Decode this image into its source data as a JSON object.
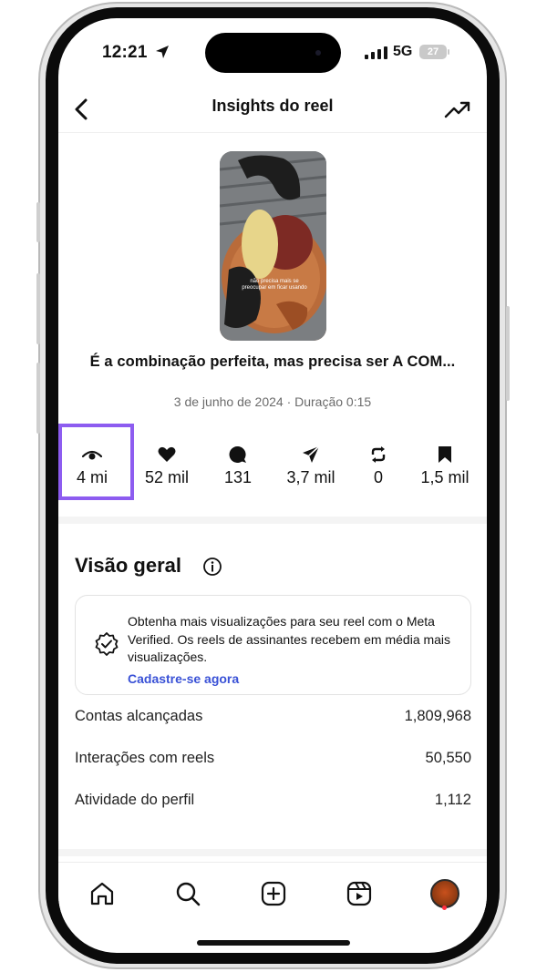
{
  "status_bar": {
    "time": "12:21",
    "network": "5G",
    "battery": "27"
  },
  "header": {
    "title": "Insights do reel"
  },
  "reel": {
    "thumbnail_overlay": "não precisa mais se preocupar em ficar usando",
    "caption": "É a combinação perfeita, mas precisa ser A COM...",
    "meta": "3 de junho de 2024 · Duração 0:15"
  },
  "metrics": [
    {
      "icon": "eye-icon",
      "value": "4 mi"
    },
    {
      "icon": "heart-icon",
      "value": "52 mil"
    },
    {
      "icon": "comment-icon",
      "value": "131"
    },
    {
      "icon": "send-icon",
      "value": "3,7 mil"
    },
    {
      "icon": "repost-icon",
      "value": "0"
    },
    {
      "icon": "bookmark-icon",
      "value": "1,5 mil"
    }
  ],
  "overview": {
    "title": "Visão geral",
    "promo": {
      "text": "Obtenha mais visualizações para seu reel com o Meta Verified. Os reels de assinantes recebem em média mais visualizações.",
      "link": "Cadastre-se agora"
    },
    "stats": [
      {
        "label": "Contas alcançadas",
        "value": "1,809,968"
      },
      {
        "label": "Interações com reels",
        "value": "50,550"
      },
      {
        "label": "Atividade do perfil",
        "value": "1,112"
      }
    ]
  },
  "tab_bar": {
    "tabs": [
      "home-icon",
      "search-icon",
      "create-icon",
      "reels-icon",
      "profile-avatar"
    ]
  },
  "colors": {
    "highlight": "#8d5cf0",
    "link": "#3951d6",
    "notification_dot": "#ff3040"
  }
}
